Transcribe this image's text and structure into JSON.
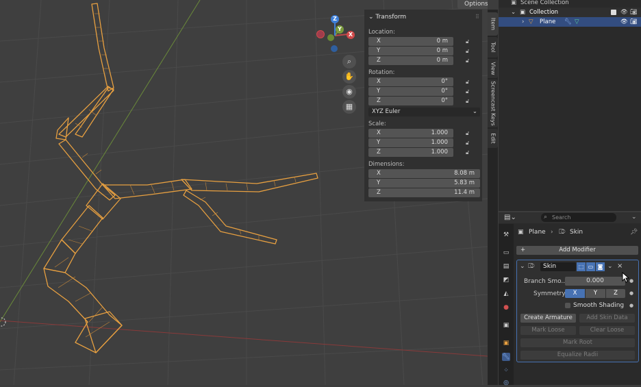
{
  "viewport": {
    "options_label": "Options",
    "gizmo": {
      "x": "X",
      "y": "Y",
      "z": "Z"
    },
    "nav_icons": [
      "zoom-icon",
      "hand-icon",
      "camera-icon",
      "grid-icon"
    ]
  },
  "transform_panel": {
    "header": "Transform",
    "location": {
      "label": "Location:",
      "rows": [
        {
          "axis": "X",
          "value": "0 m"
        },
        {
          "axis": "Y",
          "value": "0 m"
        },
        {
          "axis": "Z",
          "value": "0 m"
        }
      ]
    },
    "rotation": {
      "label": "Rotation:",
      "rows": [
        {
          "axis": "X",
          "value": "0°"
        },
        {
          "axis": "Y",
          "value": "0°"
        },
        {
          "axis": "Z",
          "value": "0°"
        }
      ]
    },
    "rotation_mode": "XYZ Euler",
    "scale": {
      "label": "Scale:",
      "rows": [
        {
          "axis": "X",
          "value": "1.000"
        },
        {
          "axis": "Y",
          "value": "1.000"
        },
        {
          "axis": "Z",
          "value": "1.000"
        }
      ]
    },
    "dimensions": {
      "label": "Dimensions:",
      "rows": [
        {
          "axis": "X",
          "value": "8.08 m"
        },
        {
          "axis": "Y",
          "value": "5.83 m"
        },
        {
          "axis": "Z",
          "value": "11.4 m"
        }
      ]
    }
  },
  "side_tabs": [
    "Item",
    "Tool",
    "View",
    "Screencast Keys",
    "Edit"
  ],
  "outliner": {
    "scene_collection": "Scene Collection",
    "collection": "Collection",
    "object": "Plane"
  },
  "properties": {
    "search_placeholder": "Search",
    "breadcrumb_object": "Plane",
    "breadcrumb_modifier": "Skin",
    "add_modifier": "Add Modifier",
    "modifier_name": "Skin",
    "branch_label": "Branch Smo...",
    "branch_value": "0.000",
    "symmetry_label": "Symmetry",
    "symmetry": [
      "X",
      "Y",
      "Z"
    ],
    "smooth_shading": "Smooth Shading",
    "create_armature": "Create Armature",
    "add_skin_data": "Add Skin Data",
    "mark_loose": "Mark Loose",
    "clear_loose": "Clear Loose",
    "mark_root": "Mark Root",
    "equalize_radii": "Equalize Radii"
  },
  "colors": {
    "accent": "#4772b3",
    "wire": "#e8a040",
    "x_axis": "#c04848",
    "y_axis": "#7a9a3c",
    "z_axis": "#3e7fd8"
  }
}
